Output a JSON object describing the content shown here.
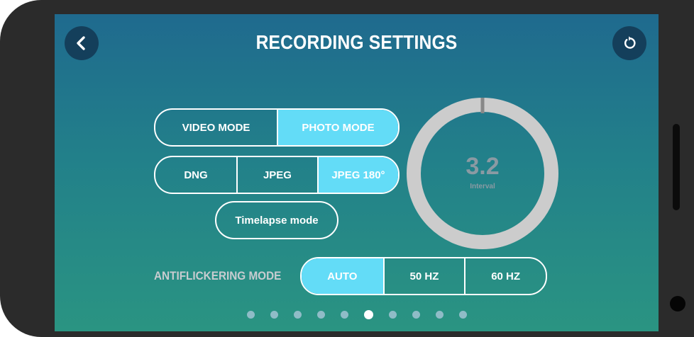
{
  "header": {
    "title": "RECORDING SETTINGS",
    "back_icon": "chevron-left-icon",
    "reset_icon": "reset-icon"
  },
  "mode_selector": {
    "options": [
      {
        "label": "VIDEO MODE",
        "active": false
      },
      {
        "label": "PHOTO MODE",
        "active": true
      }
    ]
  },
  "format_selector": {
    "options": [
      {
        "label": "DNG",
        "active": false
      },
      {
        "label": "JPEG",
        "active": false
      },
      {
        "label": "JPEG 180°",
        "active": true
      }
    ]
  },
  "timelapse_button": {
    "label": "Timelapse mode"
  },
  "interval_dial": {
    "value": "3.2",
    "caption": "Interval"
  },
  "antiflickering": {
    "label": "ANTIFLICKERING MODE",
    "options": [
      {
        "label": "AUTO",
        "active": true
      },
      {
        "label": "50 HZ",
        "active": false
      },
      {
        "label": "60 HZ",
        "active": false
      }
    ]
  },
  "pagination": {
    "total": 10,
    "current": 6
  },
  "colors": {
    "accent": "#63dcf7",
    "button_dark": "#143f5b",
    "dial_ring": "#cccccc",
    "dial_marker": "#888888",
    "label_gray": "#c8ccd0"
  }
}
